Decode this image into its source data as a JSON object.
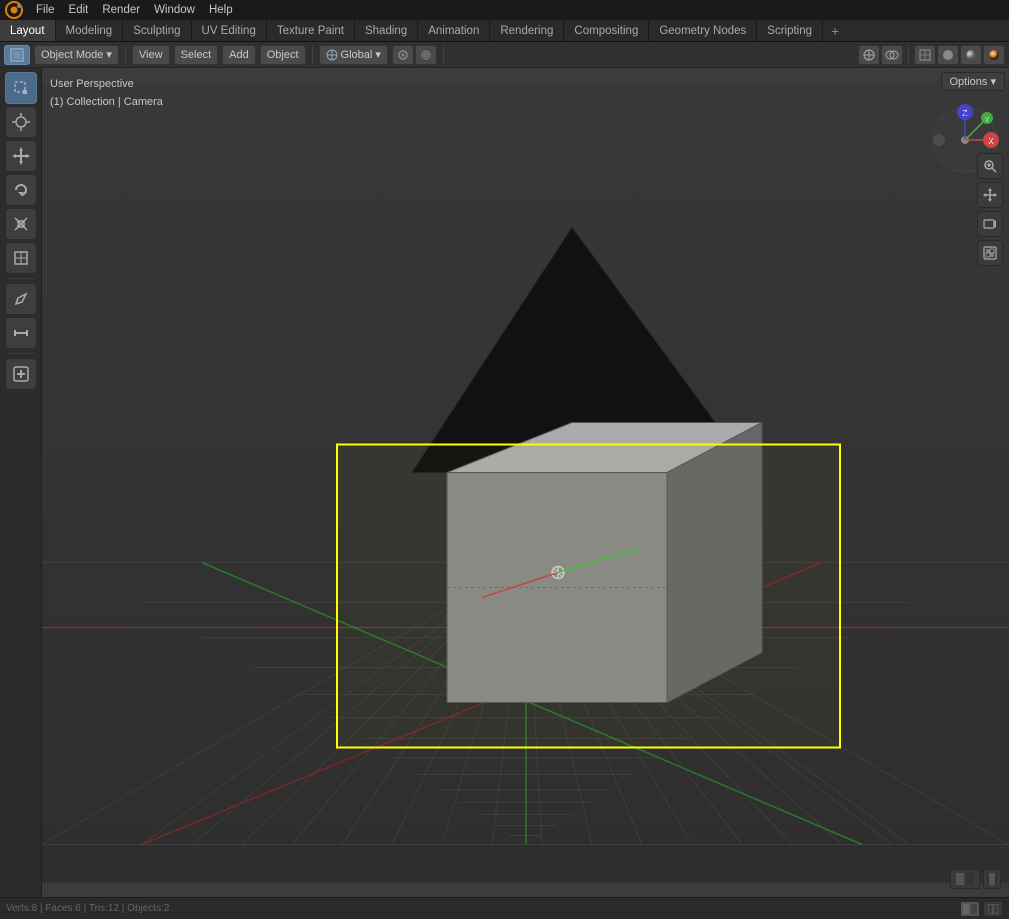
{
  "app": {
    "title": "Blender"
  },
  "top_menu": {
    "logo": "🔵",
    "items": [
      "File",
      "Edit",
      "Render",
      "Window",
      "Help"
    ]
  },
  "workspace_tabs": {
    "tabs": [
      {
        "id": "layout",
        "label": "Layout",
        "active": true
      },
      {
        "id": "modeling",
        "label": "Modeling",
        "active": false
      },
      {
        "id": "sculpting",
        "label": "Sculpting",
        "active": false
      },
      {
        "id": "uv-editing",
        "label": "UV Editing",
        "active": false
      },
      {
        "id": "texture-paint",
        "label": "Texture Paint",
        "active": false
      },
      {
        "id": "shading",
        "label": "Shading",
        "active": false
      },
      {
        "id": "animation",
        "label": "Animation",
        "active": false
      },
      {
        "id": "rendering",
        "label": "Rendering",
        "active": false
      },
      {
        "id": "compositing",
        "label": "Compositing",
        "active": false
      },
      {
        "id": "geometry-nodes",
        "label": "Geometry Nodes",
        "active": false
      },
      {
        "id": "scripting",
        "label": "Scripting",
        "active": false
      }
    ],
    "add_label": "+"
  },
  "toolbar": {
    "mode_selector": "Object Mode",
    "view_label": "View",
    "select_label": "Select",
    "add_label": "Add",
    "object_label": "Object",
    "transform_label": "Global",
    "options_label": "Options ▾"
  },
  "viewport": {
    "info_line1": "User Perspective",
    "info_line2": "(1) Collection | Camera",
    "options_btn": "Options ▾"
  },
  "left_tools": [
    {
      "id": "select-box",
      "icon": "⬚",
      "active": true
    },
    {
      "id": "cursor",
      "icon": "⊕"
    },
    {
      "id": "move",
      "icon": "✛"
    },
    {
      "id": "rotate",
      "icon": "↻"
    },
    {
      "id": "scale",
      "icon": "⤢"
    },
    {
      "id": "transform",
      "icon": "⊞"
    },
    {
      "id": "sep1",
      "separator": true
    },
    {
      "id": "annotate",
      "icon": "✏"
    },
    {
      "id": "measure",
      "icon": "📏"
    },
    {
      "id": "sep2",
      "separator": true
    },
    {
      "id": "add-object",
      "icon": "⊕"
    }
  ],
  "right_tools": [
    {
      "id": "zoom-in",
      "icon": "🔍"
    },
    {
      "id": "pan",
      "icon": "✋"
    },
    {
      "id": "camera",
      "icon": "📷"
    },
    {
      "id": "viewport-shading",
      "icon": "⬛"
    }
  ],
  "bottom_bar": {
    "icons": [
      {
        "id": "icon1",
        "label": "▌▌",
        "active": false
      },
      {
        "id": "icon2",
        "label": "▐",
        "active": false
      },
      {
        "id": "icon3",
        "label": "▐▌",
        "active": false
      }
    ]
  }
}
